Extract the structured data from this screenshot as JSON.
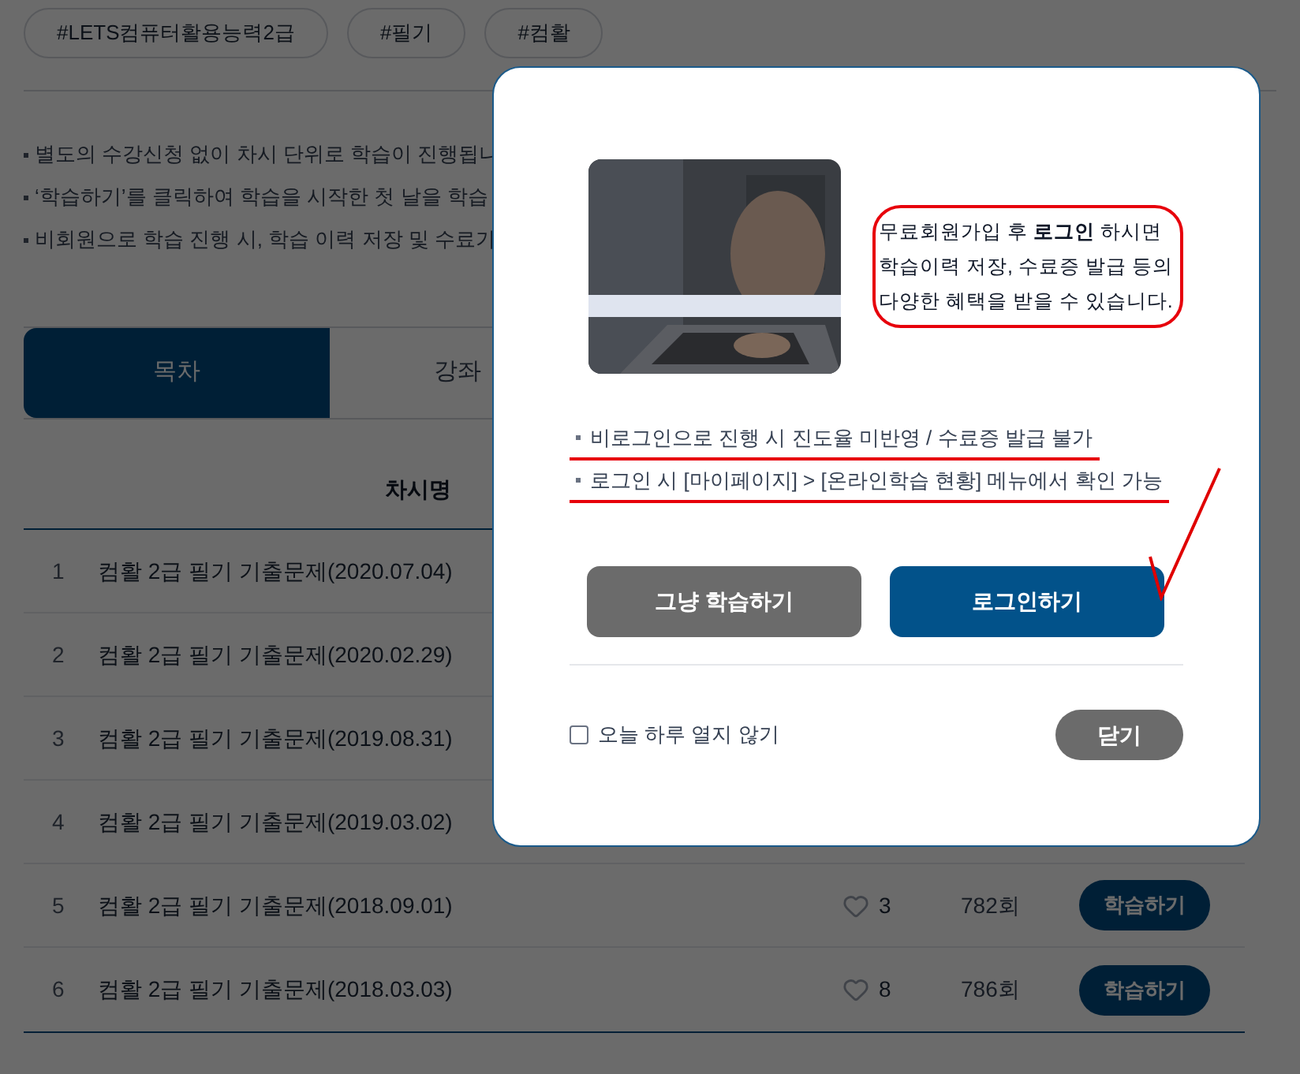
{
  "tags": [
    "#LETS컴퓨터활용능력2급",
    "#필기",
    "#컴활"
  ],
  "notices": [
    "별도의 수강신청 없이 차시 단위로 학습이 진행됩니",
    "‘학습하기’를 클릭하여 학습을 시작한 첫 날을 학습",
    "비회원으로 학습 진행 시, 학습 이력 저장 및 수료가"
  ],
  "tabs": [
    {
      "label": "목차",
      "selected": true
    },
    {
      "label": "강좌",
      "selected": false
    }
  ],
  "table": {
    "columns": [
      {
        "label": "차시명"
      }
    ],
    "rows": [
      {
        "no": "1",
        "title": "컴활 2급 필기 기출문제(2020.07.04)"
      },
      {
        "no": "2",
        "title": "컴활 2급 필기 기출문제(2020.02.29)"
      },
      {
        "no": "3",
        "title": "컴활 2급 필기 기출문제(2019.08.31)"
      },
      {
        "no": "4",
        "title": "컴활 2급 필기 기출문제(2019.03.02)"
      },
      {
        "no": "5",
        "title": "컴활 2급 필기 기출문제(2018.09.01)",
        "likes": "3",
        "views": "782회",
        "action": "학습하기"
      },
      {
        "no": "6",
        "title": "컴활 2급 필기 기출문제(2018.03.03)",
        "likes": "8",
        "views": "786회",
        "action": "학습하기"
      }
    ]
  },
  "modal": {
    "thumbnail": {
      "kind": "picture"
    },
    "promo_text": "무료회원가입 후 **로그인** 하시면 학습이력 저장, 수료증 발급 등의 다양한 혜택을 받을 수 있습니다.",
    "notes": [
      "비로그인으로 진행 시 진도율 미반영 / 수료증 발급 불가",
      "로그인 시 [마이페이지] > [온라인학습 현황] 메뉴에서 확인 가능"
    ],
    "buttons": [
      {
        "label": "그냥 학습하기",
        "kind": "secondary"
      },
      {
        "label": "로그인하기",
        "kind": "primary"
      }
    ],
    "dont_show": {
      "label": "오늘 하루 열지 않기",
      "checked": false
    },
    "close_button": "닫기"
  }
}
